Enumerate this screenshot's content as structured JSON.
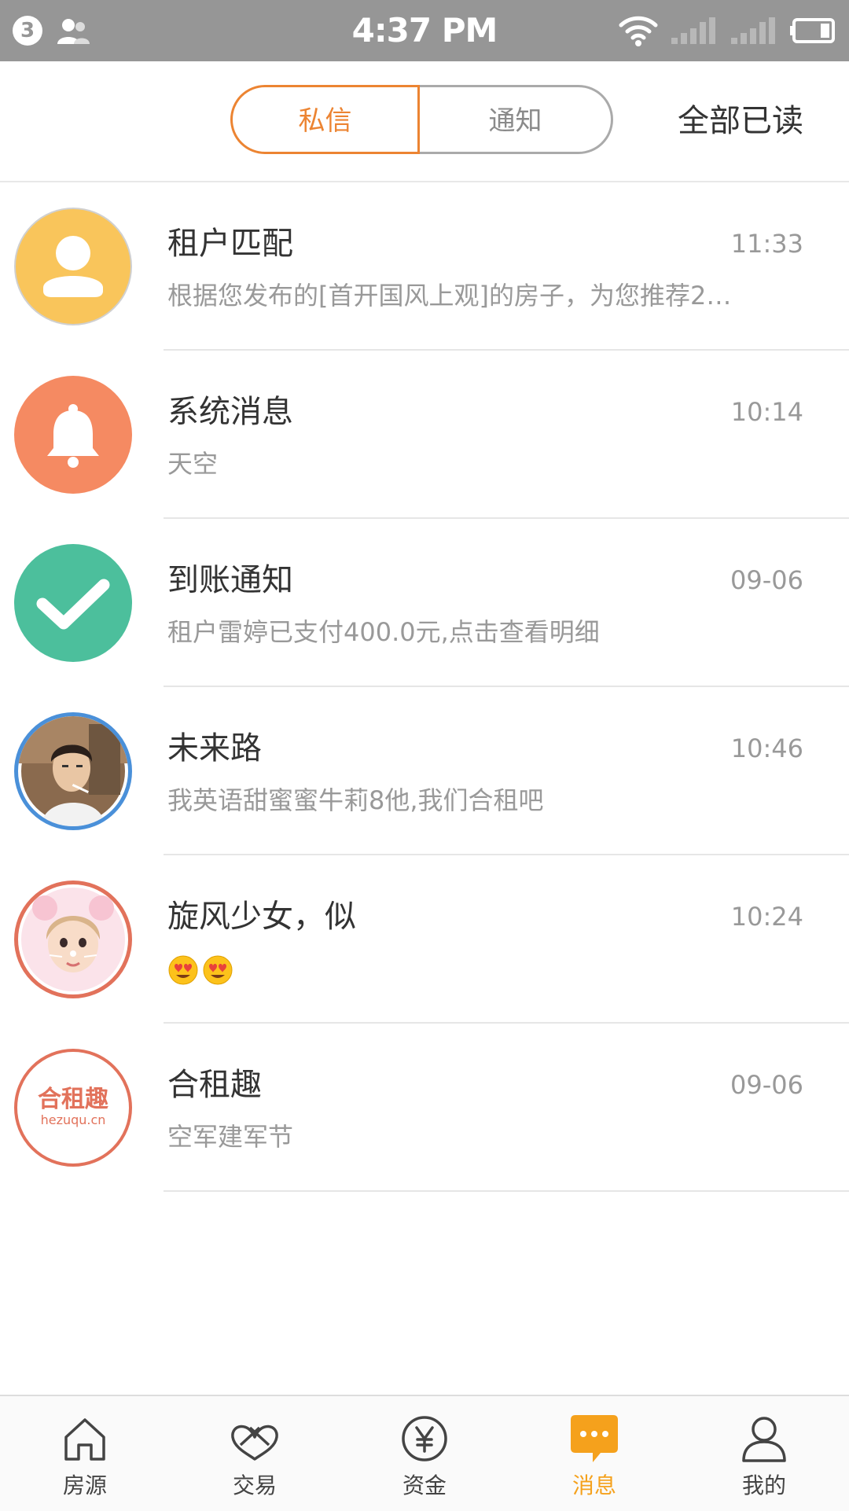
{
  "status_bar": {
    "notification_count": "3",
    "time": "4:37 PM"
  },
  "header": {
    "tabs": [
      {
        "label": "私信",
        "selected": true
      },
      {
        "label": "通知",
        "selected": false
      }
    ],
    "mark_all_read": "全部已读"
  },
  "messages": [
    {
      "name": "租户匹配",
      "time": "11:33",
      "preview": "根据您发布的[首开国风上观]的房子，为您推荐2…",
      "avatar": "person-icon",
      "avatar_color": "#f9c55b"
    },
    {
      "name": "系统消息",
      "time": "10:14",
      "preview": "天空",
      "avatar": "bell-icon",
      "avatar_color": "#f58a62"
    },
    {
      "name": "到账通知",
      "time": "09-06",
      "preview": "租户雷婷已支付400.0元,点击查看明细",
      "avatar": "checkmark-icon",
      "avatar_color": "#4cbf9c"
    },
    {
      "name": "未来路",
      "time": "10:46",
      "preview": "我英语甜蜜蜜牛莉8他,我们合租吧",
      "avatar": "user-photo",
      "avatar_color": "#4a90d9"
    },
    {
      "name": "旋风少女，似",
      "time": "10:24",
      "preview": "",
      "avatar": "user-photo",
      "avatar_color": "#e2725b"
    },
    {
      "name": "合租趣",
      "time": "09-06",
      "preview": "空军建军节",
      "avatar": "hezuqu-logo",
      "avatar_color": "#e2725b"
    }
  ],
  "logo": {
    "line1": "合租趣",
    "line2": "hezuqu.cn"
  },
  "bottom_nav": [
    {
      "label": "房源",
      "icon": "house-icon",
      "active": false
    },
    {
      "label": "交易",
      "icon": "handshake-icon",
      "active": false
    },
    {
      "label": "资金",
      "icon": "yuan-icon",
      "active": false
    },
    {
      "label": "消息",
      "icon": "message-icon",
      "active": true
    },
    {
      "label": "我的",
      "icon": "profile-icon",
      "active": false
    }
  ],
  "colors": {
    "accent": "#ec8432",
    "nav_active": "#f5a11c",
    "status_bar": "#969696"
  }
}
